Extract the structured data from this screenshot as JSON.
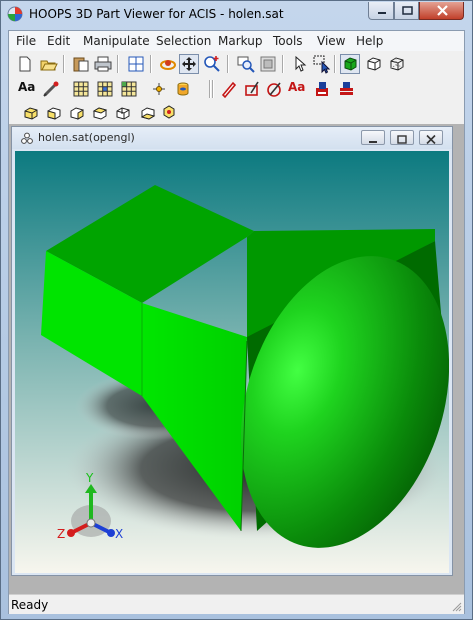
{
  "window": {
    "title": "HOOPS 3D Part Viewer for ACIS - holen.sat",
    "minimize_label": "",
    "maximize_label": "",
    "close_label": ""
  },
  "menu": [
    "File",
    "Edit",
    "Manipulate",
    "Selection",
    "Markup",
    "Tools",
    "View",
    "Help"
  ],
  "toolbar": {
    "row1": [
      "new-icon",
      "open-icon",
      "paste-icon",
      "print-icon",
      "fit-view-icon",
      "orbit-icon",
      "pan-icon",
      "zoom-icon",
      "zoom-window-icon",
      "zoom-extents-icon",
      "select-icon",
      "select-area-icon",
      "shaded-cube-icon",
      "wireframe-cube-icon",
      "hidden-line-cube-icon"
    ],
    "row2_text": {
      "annotate": "Aa",
      "markup_text": "Aa"
    },
    "row2": [
      "text-annotation-icon",
      "measure-icon",
      "grid-icon",
      "grid-fill-icon",
      "grid-alt-icon",
      "point-icon",
      "markup-pen-icon",
      "markup-rectangle-icon",
      "markup-circle-icon",
      "markup-text-icon",
      "markup-save-icon",
      "markup-layers-icon"
    ],
    "row3": [
      "iso-view-icon",
      "front-view-icon",
      "back-view-icon",
      "left-view-icon",
      "right-view-icon",
      "top-view-icon"
    ]
  },
  "child_window": {
    "title": "holen.sat(opengl)"
  },
  "axis_triad": {
    "x": "X",
    "y": "Y",
    "z": "Z"
  },
  "colors": {
    "model_green": "#00e600",
    "model_dark": "#005f00",
    "viewport_top": "#0c7a80",
    "viewport_bottom": "#f7f6ee"
  },
  "status": {
    "text": "Ready"
  }
}
